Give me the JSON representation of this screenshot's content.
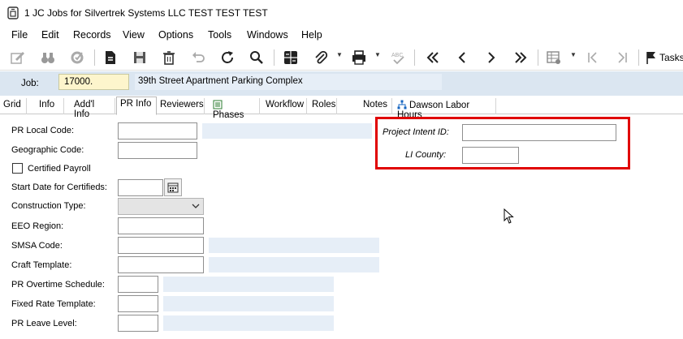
{
  "window": {
    "title": "1 JC Jobs for Silvertrek Systems LLC TEST TEST TEST"
  },
  "menu": {
    "items": [
      "File",
      "Edit",
      "Records",
      "View",
      "Options",
      "Tools",
      "Windows",
      "Help"
    ]
  },
  "toolbar": {
    "tasks_label": "Tasks"
  },
  "job": {
    "label": "Job:",
    "value": "17000.",
    "description": "39th Street Apartment Parking Complex"
  },
  "tabs": [
    "Grid",
    "Info",
    "Add'l Info",
    "PR Info",
    "Reviewers",
    "Phases",
    "Workflow",
    "Roles",
    "Notes",
    "Dawson Labor Hours"
  ],
  "active_tab": "PR Info",
  "form": {
    "pr_local_code": {
      "label": "PR Local Code:",
      "value": ""
    },
    "geographic_code": {
      "label": "Geographic Code:",
      "value": ""
    },
    "certified_payroll": {
      "label": "Certified Payroll",
      "checked": false
    },
    "start_date_certified": {
      "label": "Start Date for Certifieds:",
      "value": ""
    },
    "construction_type": {
      "label": "Construction Type:",
      "value": ""
    },
    "eeo_region": {
      "label": "EEO Region:",
      "value": ""
    },
    "smsa_code": {
      "label": "SMSA Code:",
      "value": ""
    },
    "craft_template": {
      "label": "Craft Template:",
      "value": ""
    },
    "pr_overtime_schedule": {
      "label": "PR Overtime Schedule:",
      "value": ""
    },
    "fixed_rate_template": {
      "label": "Fixed Rate Template:",
      "value": ""
    },
    "pr_leave_level": {
      "label": "PR Leave Level:",
      "value": ""
    },
    "project_intent_id": {
      "label": "Project Intent ID:",
      "value": ""
    },
    "li_county": {
      "label": "LI County:",
      "value": ""
    }
  },
  "colors": {
    "highlight_border": "#e00000",
    "job_input_bg": "#fdf5cc",
    "readonly_bg": "#e6eef7",
    "job_bar_bg": "#dbe6f1"
  }
}
